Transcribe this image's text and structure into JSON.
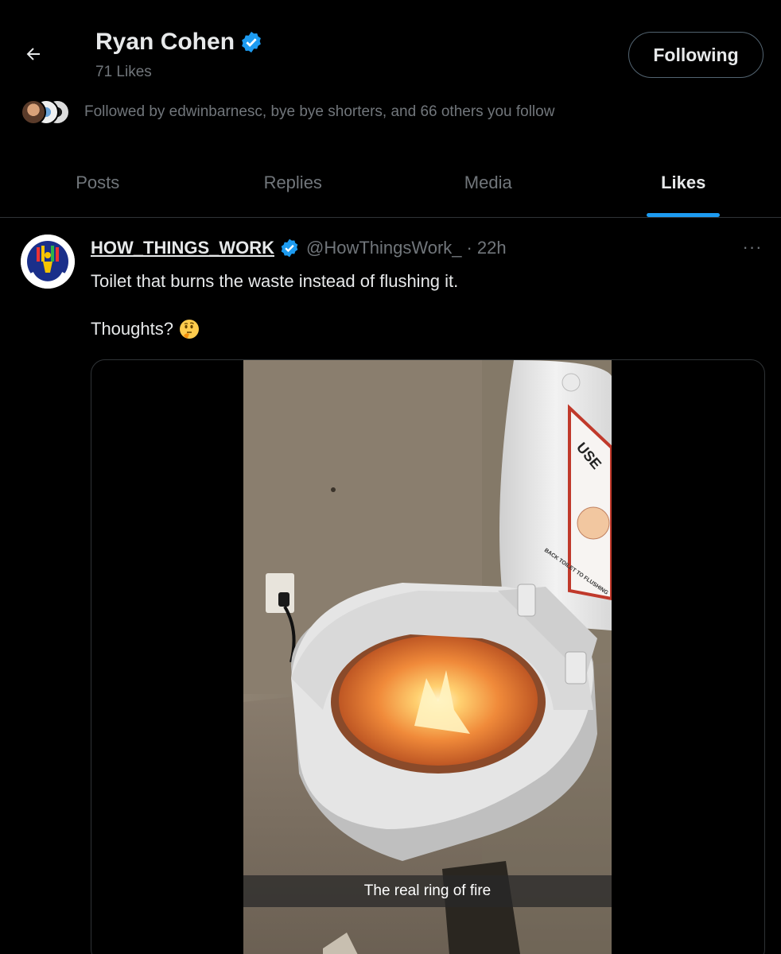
{
  "profile": {
    "name": "Ryan Cohen",
    "likes_count": "71 Likes",
    "follow_button": "Following",
    "followed_by": "Followed by edwinbarnesc, bye bye shorters, and 66 others you follow"
  },
  "tabs": [
    {
      "label": "Posts",
      "active": false
    },
    {
      "label": "Replies",
      "active": false
    },
    {
      "label": "Media",
      "active": false
    },
    {
      "label": "Likes",
      "active": true
    }
  ],
  "post": {
    "author_name": "HOW_THINGS_WORK",
    "author_handle": "@HowThingsWork_",
    "separator": "·",
    "time": "22h",
    "more": "···",
    "text_line1": "Toilet that burns the waste instead of flushing it.",
    "text_line2": "Thoughts?",
    "emoji": "thinking-face",
    "media": {
      "caption": "The real ring of fire",
      "sign_text": "USE",
      "sign_text2": "BACK TOILET TO FLUSHING"
    }
  },
  "colors": {
    "background": "#000000",
    "accent": "#1d9bf0",
    "text_primary": "#e7e9ea",
    "text_secondary": "#71767b",
    "border": "#2f3336"
  }
}
